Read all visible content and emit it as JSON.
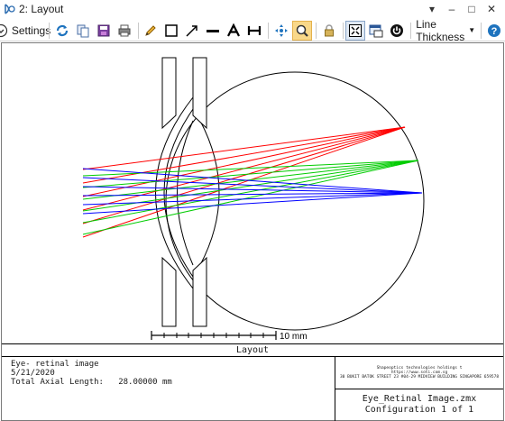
{
  "window": {
    "title": "2: Layout",
    "controls": {
      "dropdown": "▾",
      "minimize": "–",
      "maximize": "□",
      "close": "✕"
    }
  },
  "toolbar": {
    "settings_label": "Settings",
    "line_thickness_label": "Line Thickness",
    "tools": [
      "settings-icon",
      "refresh-icon",
      "copy-icon",
      "save-icon",
      "print-icon",
      "pencil-icon",
      "rectangle-icon",
      "arrow-icon",
      "line-icon",
      "text-icon",
      "dimension-icon",
      "pan-icon",
      "zoom-icon",
      "lock-icon",
      "fit-icon",
      "window-icon",
      "power-icon",
      "help-icon"
    ]
  },
  "plot": {
    "scale_label": "10 mm",
    "ray_colors": {
      "red": "#ff0000",
      "green": "#00cc00",
      "blue": "#0000ff"
    }
  },
  "footer": {
    "caption": "Layout",
    "info_lines": [
      "Eye- retinal image",
      "5/21/2020",
      "Total Axial Length:   28.00000 mm"
    ],
    "company_lines": [
      "Shapeoptics technologies holdings t",
      "https://www.soti.com.sg",
      "30 BUKIT BATOK STREET 23 #04-29 MIDVIEW BUILDING SINGAPORE 659578"
    ],
    "file_name": "Eye_Retinal Image.zmx",
    "configuration": "Configuration 1 of 1"
  }
}
